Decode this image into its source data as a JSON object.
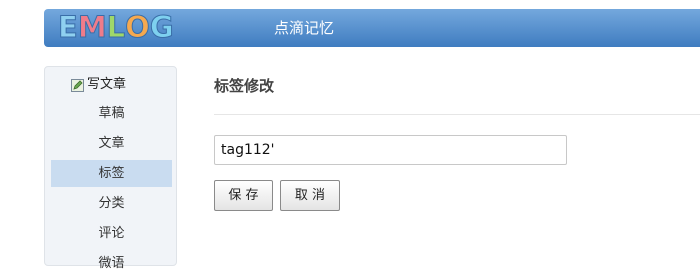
{
  "header": {
    "logo_letters": [
      "E",
      "M",
      "L",
      "O",
      "G"
    ],
    "logo_colors": [
      "#8fd0f0",
      "#f07c8a",
      "#9fd86a",
      "#f5a950",
      "#7ed0ef"
    ],
    "site_title": "点滴记忆"
  },
  "sidebar": {
    "write_label": "写文章",
    "write_icon": "edit-icon",
    "items": [
      {
        "label": "草稿",
        "active": false
      },
      {
        "label": "文章",
        "active": false
      },
      {
        "label": "标签",
        "active": true
      },
      {
        "label": "分类",
        "active": false
      },
      {
        "label": "评论",
        "active": false
      },
      {
        "label": "微语",
        "active": false
      }
    ],
    "active_color": "#c9dcf0"
  },
  "main": {
    "title": "标签修改",
    "tag_input": {
      "value": "tag112'"
    },
    "save_label": "保 存",
    "cancel_label": "取 消"
  }
}
